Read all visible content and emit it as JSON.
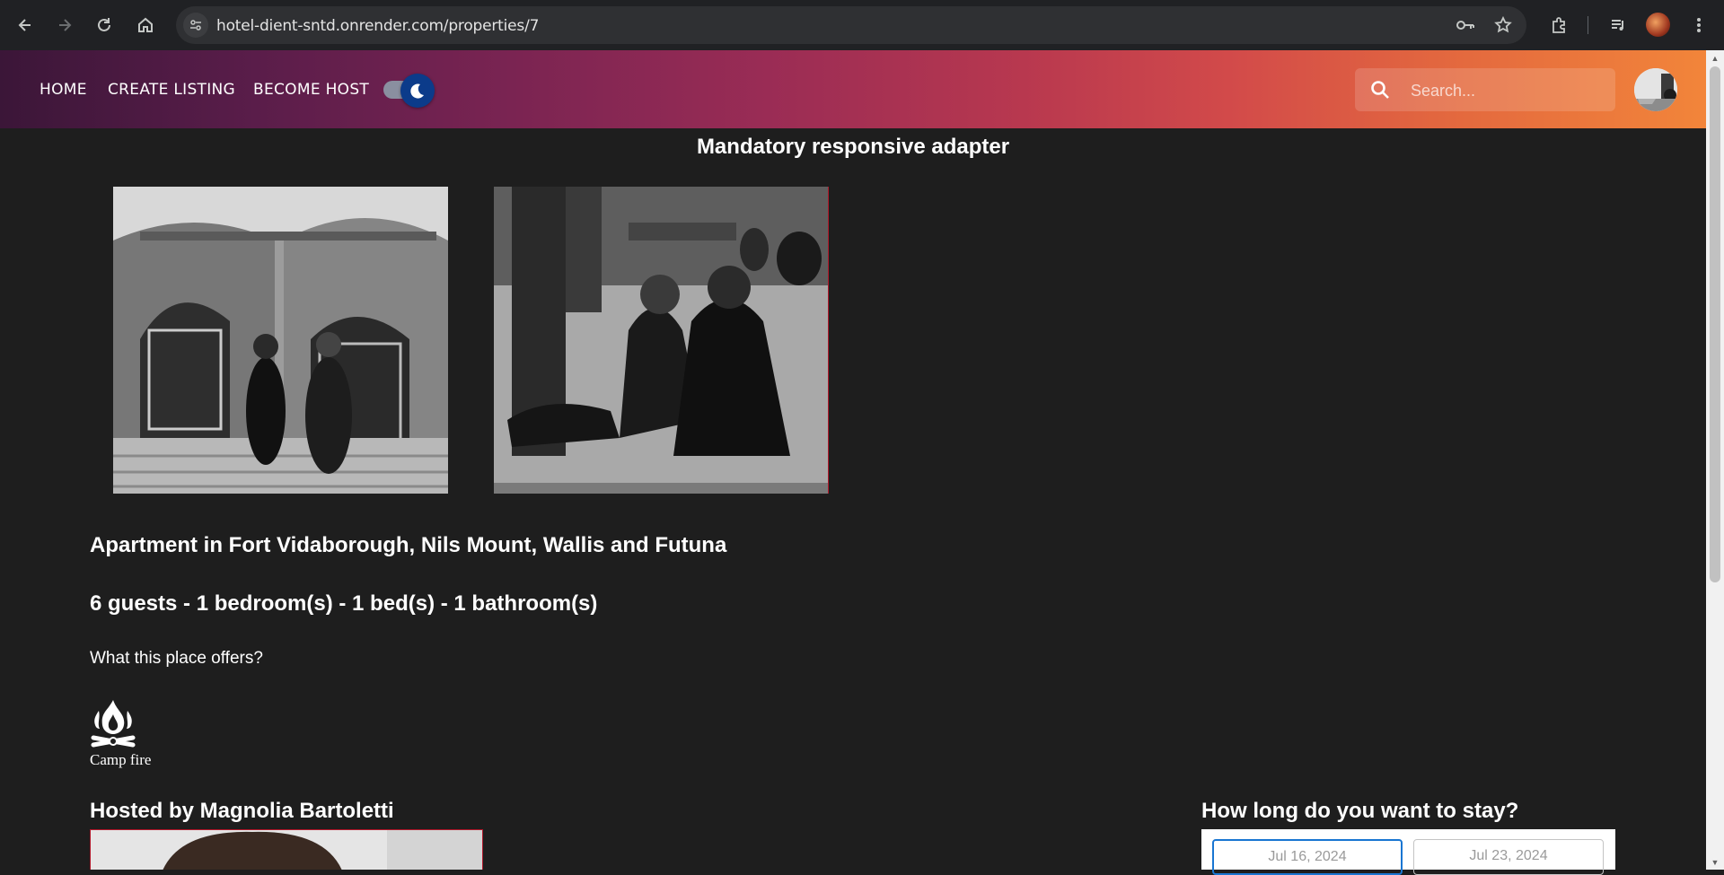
{
  "browser": {
    "url": "hotel-dient-sntd.onrender.com/properties/7"
  },
  "nav": {
    "home": "HOME",
    "create_listing": "CREATE LISTING",
    "become_host": "BECOME HOST",
    "dark_mode_on": true,
    "search_placeholder": "Search..."
  },
  "property": {
    "title": "Mandatory responsive adapter",
    "location": "Apartment in Fort Vidaborough, Nils Mount, Wallis and Futuna",
    "specs": "6 guests - 1 bedroom(s) - 1 bed(s) - 1 bathroom(s)",
    "offers_label": "What this place offers?",
    "amenities": [
      {
        "label": "Camp fire",
        "icon": "campfire-icon"
      }
    ],
    "host_label": "Hosted by Magnolia Bartoletti"
  },
  "booking": {
    "question": "How long do you want to stay?",
    "start_date": "Jul 16, 2024",
    "end_date": "Jul 23, 2024"
  },
  "colors": {
    "page_bg": "#1e1e1e",
    "header_gradient_start": "#3b1638",
    "header_gradient_end": "#f2853a",
    "toggle_thumb": "#0b3b8a",
    "accent_red": "#b0182a"
  }
}
